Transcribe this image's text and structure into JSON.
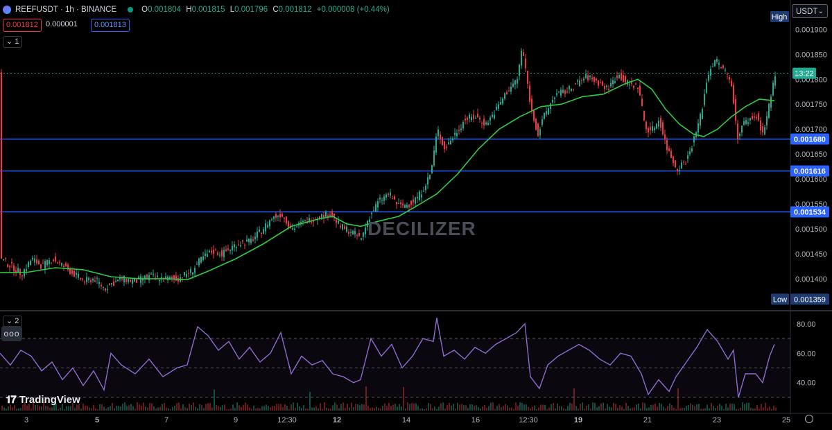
{
  "header": {
    "symbol": "REEFUSDT · 1h · BINANCE",
    "ohlc": {
      "o_label": "O",
      "o": "0.001804",
      "h_label": "H",
      "h": "0.001815",
      "l_label": "L",
      "l": "0.001796",
      "c_label": "C",
      "c": "0.001812",
      "change": "+0.000008 (+0.44%)"
    },
    "bid": "0.001812",
    "spread": "0.000001",
    "ask": "0.001813",
    "pane1_label": "1",
    "pane2_label": "2"
  },
  "toolbar": {
    "currency": "USDT",
    "currency_chevron": "chevron-down-icon",
    "more_button": "ooo"
  },
  "watermark": "DECILIZER",
  "branding": "TradingView",
  "colors": {
    "up": "#22ab94",
    "down": "#f23645",
    "ma": "#2ecc40",
    "rsi": "#8e6ccf",
    "level": "#2962ff",
    "last": "#22ab94"
  },
  "chart_data": {
    "type": "line",
    "description_series": "candlestick price with moving average and RSI subpane",
    "x_ticks": [
      "3",
      "5",
      "7",
      "9",
      "12:30",
      "12",
      "14",
      "16",
      "12:30",
      "19",
      "21",
      "23",
      "25"
    ],
    "price_axis": {
      "ticks": [
        "0.001900",
        "0.001850",
        "0.001800",
        "0.001750",
        "0.001700",
        "0.001650",
        "0.001600",
        "0.001550",
        "0.001500",
        "0.001450",
        "0.001400"
      ],
      "ylim": [
        0.00134,
        0.001945
      ],
      "high_label": "High",
      "low_label": "Low",
      "low_value": "0.001359",
      "last_time": "13:22"
    },
    "levels": [
      "0.001680",
      "0.001616",
      "0.001534"
    ],
    "last_price": 0.001812,
    "price_path": [
      [
        0,
        0.00144
      ],
      [
        15,
        0.001425
      ],
      [
        30,
        0.00141
      ],
      [
        45,
        0.00144
      ],
      [
        60,
        0.001425
      ],
      [
        75,
        0.00144
      ],
      [
        90,
        0.001425
      ],
      [
        105,
        0.00141
      ],
      [
        120,
        0.001395
      ],
      [
        135,
        0.0014
      ],
      [
        150,
        0.00138
      ],
      [
        160,
        0.00139
      ],
      [
        175,
        0.0014
      ],
      [
        195,
        0.001395
      ],
      [
        215,
        0.001405
      ],
      [
        235,
        0.0014
      ],
      [
        255,
        0.0014
      ],
      [
        275,
        0.001415
      ],
      [
        290,
        0.00144
      ],
      [
        305,
        0.001455
      ],
      [
        320,
        0.00145
      ],
      [
        340,
        0.00147
      ],
      [
        360,
        0.001475
      ],
      [
        375,
        0.001495
      ],
      [
        390,
        0.00152
      ],
      [
        405,
        0.00153
      ],
      [
        420,
        0.0015
      ],
      [
        440,
        0.001515
      ],
      [
        460,
        0.001525
      ],
      [
        475,
        0.00153
      ],
      [
        490,
        0.001505
      ],
      [
        505,
        0.001495
      ],
      [
        520,
        0.00148
      ],
      [
        530,
        0.00152
      ],
      [
        545,
        0.001555
      ],
      [
        560,
        0.00157
      ],
      [
        575,
        0.001545
      ],
      [
        590,
        0.00155
      ],
      [
        605,
        0.00157
      ],
      [
        620,
        0.00161
      ],
      [
        630,
        0.0017
      ],
      [
        640,
        0.00166
      ],
      [
        655,
        0.00169
      ],
      [
        670,
        0.00172
      ],
      [
        685,
        0.001725
      ],
      [
        700,
        0.00171
      ],
      [
        715,
        0.00174
      ],
      [
        730,
        0.001775
      ],
      [
        745,
        0.0018
      ],
      [
        752,
        0.001865
      ],
      [
        758,
        0.00181
      ],
      [
        765,
        0.00174
      ],
      [
        775,
        0.00169
      ],
      [
        785,
        0.00173
      ],
      [
        800,
        0.00177
      ],
      [
        815,
        0.001775
      ],
      [
        830,
        0.00179
      ],
      [
        845,
        0.001805
      ],
      [
        860,
        0.001795
      ],
      [
        875,
        0.00178
      ],
      [
        890,
        0.00181
      ],
      [
        905,
        0.00179
      ],
      [
        920,
        0.001785
      ],
      [
        930,
        0.0017
      ],
      [
        940,
        0.0017
      ],
      [
        950,
        0.00172
      ],
      [
        960,
        0.001665
      ],
      [
        975,
        0.00162
      ],
      [
        990,
        0.00164
      ],
      [
        1000,
        0.00168
      ],
      [
        1010,
        0.00173
      ],
      [
        1020,
        0.00181
      ],
      [
        1030,
        0.00184
      ],
      [
        1045,
        0.001815
      ],
      [
        1055,
        0.00179
      ],
      [
        1062,
        0.00168
      ],
      [
        1070,
        0.00171
      ],
      [
        1080,
        0.00172
      ],
      [
        1090,
        0.001725
      ],
      [
        1100,
        0.00169
      ],
      [
        1110,
        0.00176
      ],
      [
        1117,
        0.001812
      ]
    ],
    "ma_path": [
      [
        0,
        0.001412
      ],
      [
        40,
        0.001413
      ],
      [
        80,
        0.001422
      ],
      [
        120,
        0.001418
      ],
      [
        160,
        0.001404
      ],
      [
        200,
        0.0014
      ],
      [
        240,
        0.0014
      ],
      [
        270,
        0.001398
      ],
      [
        300,
        0.001415
      ],
      [
        340,
        0.00144
      ],
      [
        380,
        0.00147
      ],
      [
        420,
        0.001505
      ],
      [
        460,
        0.00152
      ],
      [
        480,
        0.001525
      ],
      [
        500,
        0.00151
      ],
      [
        520,
        0.001505
      ],
      [
        545,
        0.001515
      ],
      [
        575,
        0.001525
      ],
      [
        600,
        0.001545
      ],
      [
        630,
        0.00157
      ],
      [
        660,
        0.00161
      ],
      [
        690,
        0.00166
      ],
      [
        720,
        0.0017
      ],
      [
        750,
        0.001725
      ],
      [
        780,
        0.001745
      ],
      [
        810,
        0.00175
      ],
      [
        840,
        0.001765
      ],
      [
        870,
        0.00177
      ],
      [
        900,
        0.00179
      ],
      [
        920,
        0.0018
      ],
      [
        940,
        0.00178
      ],
      [
        960,
        0.00174
      ],
      [
        980,
        0.00171
      ],
      [
        1000,
        0.00169
      ],
      [
        1015,
        0.001685
      ],
      [
        1035,
        0.0017
      ],
      [
        1055,
        0.001725
      ],
      [
        1075,
        0.001745
      ],
      [
        1095,
        0.00176
      ],
      [
        1117,
        0.001757
      ]
    ],
    "rsi": {
      "ticks": [
        "80.00",
        "60.00",
        "40.00"
      ],
      "ylim": [
        21,
        87
      ],
      "upper": 70,
      "mid": 50,
      "lower": 30,
      "path": [
        [
          0,
          60
        ],
        [
          15,
          52
        ],
        [
          30,
          62
        ],
        [
          45,
          58
        ],
        [
          60,
          48
        ],
        [
          75,
          54
        ],
        [
          90,
          42
        ],
        [
          105,
          50
        ],
        [
          120,
          38
        ],
        [
          135,
          48
        ],
        [
          150,
          35
        ],
        [
          160,
          60
        ],
        [
          175,
          52
        ],
        [
          195,
          46
        ],
        [
          215,
          56
        ],
        [
          235,
          44
        ],
        [
          255,
          50
        ],
        [
          270,
          52
        ],
        [
          285,
          78
        ],
        [
          300,
          72
        ],
        [
          315,
          62
        ],
        [
          330,
          68
        ],
        [
          345,
          56
        ],
        [
          360,
          64
        ],
        [
          375,
          54
        ],
        [
          390,
          60
        ],
        [
          405,
          74
        ],
        [
          420,
          46
        ],
        [
          435,
          58
        ],
        [
          450,
          52
        ],
        [
          465,
          55
        ],
        [
          480,
          46
        ],
        [
          495,
          44
        ],
        [
          510,
          40
        ],
        [
          520,
          42
        ],
        [
          535,
          70
        ],
        [
          550,
          58
        ],
        [
          565,
          66
        ],
        [
          580,
          50
        ],
        [
          595,
          58
        ],
        [
          610,
          70
        ],
        [
          625,
          68
        ],
        [
          630,
          84
        ],
        [
          640,
          58
        ],
        [
          655,
          62
        ],
        [
          670,
          56
        ],
        [
          685,
          64
        ],
        [
          700,
          60
        ],
        [
          715,
          66
        ],
        [
          730,
          70
        ],
        [
          745,
          74
        ],
        [
          757,
          80
        ],
        [
          765,
          44
        ],
        [
          778,
          36
        ],
        [
          790,
          52
        ],
        [
          805,
          58
        ],
        [
          820,
          62
        ],
        [
          835,
          66
        ],
        [
          850,
          62
        ],
        [
          865,
          56
        ],
        [
          880,
          52
        ],
        [
          895,
          60
        ],
        [
          910,
          58
        ],
        [
          925,
          46
        ],
        [
          935,
          32
        ],
        [
          950,
          42
        ],
        [
          965,
          34
        ],
        [
          975,
          44
        ],
        [
          990,
          54
        ],
        [
          1005,
          64
        ],
        [
          1020,
          76
        ],
        [
          1035,
          68
        ],
        [
          1050,
          56
        ],
        [
          1058,
          62
        ],
        [
          1065,
          30
        ],
        [
          1075,
          46
        ],
        [
          1090,
          46
        ],
        [
          1100,
          40
        ],
        [
          1110,
          58
        ],
        [
          1117,
          66
        ]
      ]
    }
  }
}
